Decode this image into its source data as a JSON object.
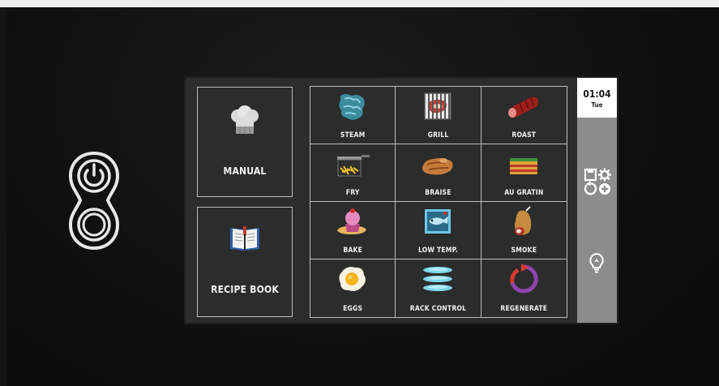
{
  "clock": {
    "time": "01:04",
    "day": "Tue"
  },
  "buttons": {
    "manual": "MANUAL",
    "recipe_book": "RECIPE BOOK"
  },
  "programs": [
    {
      "label": "STEAM",
      "icon": "steam-icon"
    },
    {
      "label": "GRILL",
      "icon": "grill-icon"
    },
    {
      "label": "ROAST",
      "icon": "roast-icon"
    },
    {
      "label": "FRY",
      "icon": "fry-icon"
    },
    {
      "label": "BRAISE",
      "icon": "braise-icon"
    },
    {
      "label": "AU GRATIN",
      "icon": "au-gratin-icon"
    },
    {
      "label": "BAKE",
      "icon": "bake-icon"
    },
    {
      "label": "LOW TEMP.",
      "icon": "low-temp-icon"
    },
    {
      "label": "SMOKE",
      "icon": "smoke-icon"
    },
    {
      "label": "EGGS",
      "icon": "eggs-icon"
    },
    {
      "label": "RACK CONTROL",
      "icon": "rack-control-icon"
    },
    {
      "label": "REGENERATE",
      "icon": "regenerate-icon"
    }
  ],
  "sidebar_icons": [
    "save-icon",
    "settings-icon",
    "restart-icon",
    "add-icon",
    "lightbulb-icon"
  ],
  "colors": {
    "screen_bg": "#2b2c2c",
    "sidebar_bg": "#8c8c8c",
    "accent_red": "#c0392b",
    "accent_blue": "#6ec6e6"
  }
}
